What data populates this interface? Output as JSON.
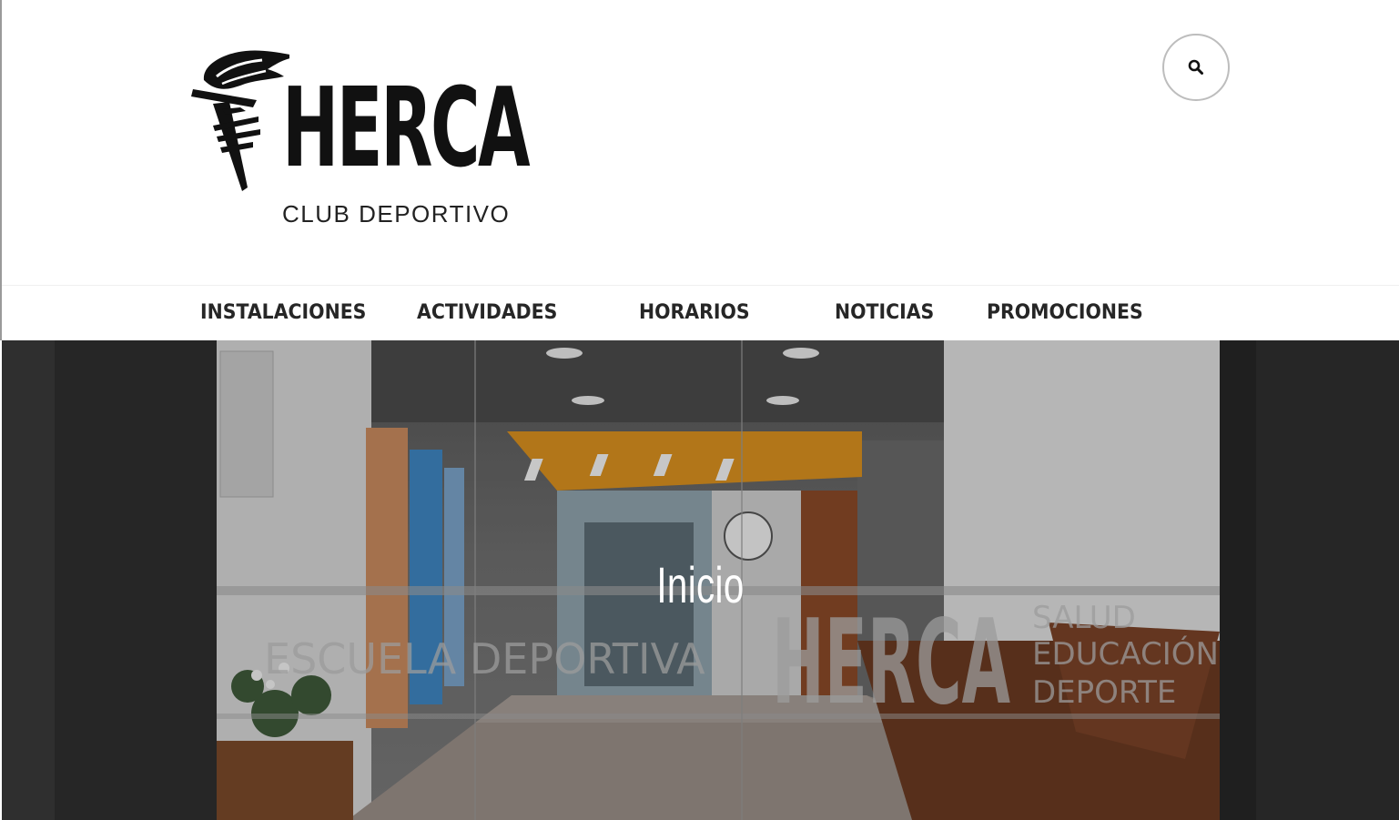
{
  "brand": {
    "name": "HERCA",
    "tagline": "CLUB DEPORTIVO"
  },
  "header": {
    "search_icon": "search-icon"
  },
  "nav": {
    "items": [
      {
        "label": "INSTALACIONES",
        "has_dropdown": false
      },
      {
        "label": "ACTIVIDADES",
        "has_dropdown": true
      },
      {
        "label": "HORARIOS",
        "has_dropdown": true
      },
      {
        "label": "NOTICIAS",
        "has_dropdown": false
      },
      {
        "label": "PROMOCIONES",
        "has_dropdown": false
      }
    ]
  },
  "hero": {
    "title": "Inicio",
    "glass_texts": {
      "left": "ESCUELA DEPORTIVA",
      "brand": "HERCA",
      "right_lines": [
        "SALUD",
        "EDUCACIÓN",
        "DEPORTE"
      ]
    }
  },
  "colors": {
    "text_dark": "#262626",
    "border_gray": "#bdbdbd",
    "accent_orange": "#d9901f",
    "wood": "#6b3a22"
  }
}
